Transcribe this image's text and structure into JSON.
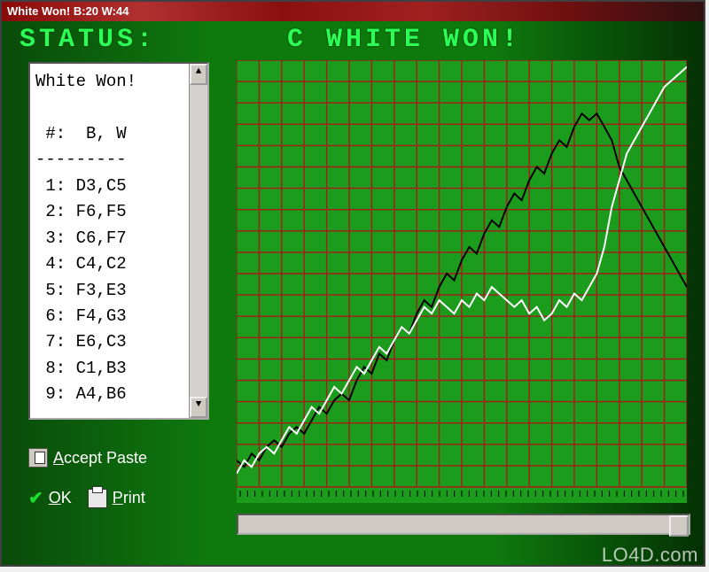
{
  "title": "White Won! B:20 W:44",
  "status": {
    "label": "STATUS:",
    "message": "C  WHITE  WON!"
  },
  "moves": {
    "header": "White Won!",
    "columns": " #:  B, W",
    "divider": "---------",
    "rows": [
      {
        "n": 1,
        "b": "D3",
        "w": "C5"
      },
      {
        "n": 2,
        "b": "F6",
        "w": "F5"
      },
      {
        "n": 3,
        "b": "C6",
        "w": "F7"
      },
      {
        "n": 4,
        "b": "C4",
        "w": "C2"
      },
      {
        "n": 5,
        "b": "F3",
        "w": "E3"
      },
      {
        "n": 6,
        "b": "F4",
        "w": "G3"
      },
      {
        "n": 7,
        "b": "E6",
        "w": "C3"
      },
      {
        "n": 8,
        "b": "C1",
        "w": "B3"
      },
      {
        "n": 9,
        "b": "A4",
        "w": "B6"
      }
    ]
  },
  "buttons": {
    "accept_paste": "Accept Paste",
    "ok": "OK",
    "print": "Print"
  },
  "chart_data": {
    "type": "line",
    "title": "",
    "xlabel": "",
    "ylabel": "",
    "xlim": [
      0,
      60
    ],
    "ylim": [
      0,
      64
    ],
    "grid": true,
    "legend": false,
    "series": [
      {
        "name": "Black",
        "color": "#000000",
        "values": [
          4,
          3,
          5,
          4,
          6,
          7,
          6,
          8,
          9,
          8,
          10,
          12,
          11,
          13,
          14,
          13,
          16,
          18,
          17,
          20,
          19,
          22,
          24,
          23,
          26,
          28,
          27,
          30,
          32,
          31,
          34,
          36,
          35,
          38,
          40,
          39,
          42,
          44,
          43,
          46,
          48,
          47,
          50,
          52,
          51,
          54,
          56,
          55,
          56,
          54,
          52,
          48,
          46,
          44,
          42,
          40,
          38,
          36,
          34,
          32,
          30
        ]
      },
      {
        "name": "White",
        "color": "#ffffff",
        "values": [
          2,
          4,
          3,
          5,
          6,
          5,
          7,
          9,
          8,
          10,
          12,
          11,
          13,
          15,
          14,
          16,
          18,
          17,
          19,
          21,
          20,
          22,
          24,
          23,
          25,
          27,
          26,
          28,
          27,
          26,
          28,
          27,
          29,
          28,
          30,
          29,
          28,
          27,
          28,
          26,
          27,
          25,
          26,
          28,
          27,
          29,
          28,
          30,
          32,
          36,
          42,
          46,
          50,
          52,
          54,
          56,
          58,
          60,
          61,
          62,
          63
        ]
      }
    ]
  },
  "watermark": "LO4D.com",
  "colors": {
    "bg": "#1c9c1c",
    "grid": "#aa1a1a"
  }
}
